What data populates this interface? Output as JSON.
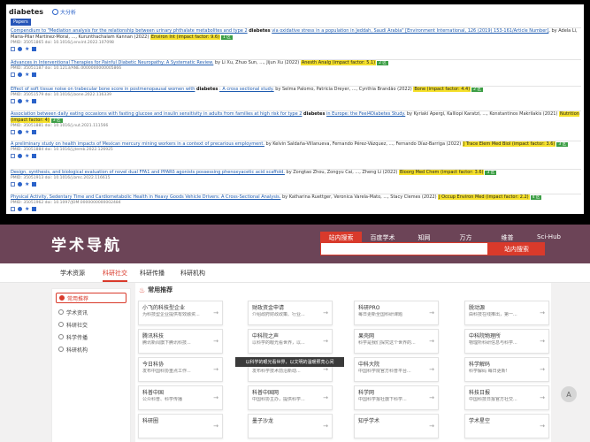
{
  "top": {
    "query": "diabetes",
    "lang_link": "大分析",
    "tab_label": "Papers",
    "results": [
      {
        "link": "Compendium to \"Mediation analysis for the relationship between urinary phthalate metabolites and type 2",
        "kw": "diabetes",
        "link2": "via oxidative stress in a population in Jeddah, Saudi Arabia\" [Environment International, 126 (2019) 153-161/Article Number]",
        "authors": ", by Adela Li, Maria-Pilar Martinez-Moral, ..., Kurunthachalam Kannan (2022)",
        "journal": "Environ Int (impact factor: 9.6)",
        "badge": "1 区",
        "meta": "PMID: 35051865 doi: 10.1016/j.envint.2022.107098"
      },
      {
        "link": "Advances in Interventional Therapies for Painful Diabetic Neuropathy: A Systematic Review.",
        "kw": "",
        "link2": "",
        "authors": " by Li Xu, Zhuo Sun, ..., Jijun Xu (2022)",
        "journal": "Anesth Analg (impact factor: 5.1)",
        "badge": "2 区",
        "meta": "PMID: 35051187 doi: 10.1213/ANE.0000000000005866"
      },
      {
        "link": "Effect of soft tissue noise on trabecular bone score in postmenopausal women with",
        "kw": "diabetes",
        "link2": ": A cross sectional study.",
        "authors": " by Selma Palomo, Patricia Dreyer, ..., Cynthia Brandão (2022)",
        "journal": "Bone (impact factor: 4.4)",
        "badge": "2 区",
        "meta": "PMID: 35051579 doi: 10.1016/j.bone.2022.116339"
      },
      {
        "link": "Association between daily eating occasions with fasting glucose and insulin sensitivity in adults from families at high risk for type 2",
        "kw": "diabetes",
        "link2": "in Europe: the Feel4Diabetes Study.",
        "authors": " by Kyriaki Apergi, Kalliopi Karatzi, ..., Konstantinos Makrilakis (2021)",
        "journal": "Nutrition (impact factor: 4)",
        "badge": "3 区",
        "meta": "PMID: 35051881 doi: 10.1016/j.nut.2021.111566"
      },
      {
        "link": "A preliminary study on health impacts of Mexican mercury mining workers in a context of precarious employment.",
        "kw": "",
        "link2": "",
        "authors": " by Kelvin Saldaña-Villanueva, Fernando Pérez-Vázquez, ..., Fernando Díaz-Barriga (2022)",
        "journal": "J Trace Elem Med Biol (impact factor: 3.6)",
        "badge": "3 区",
        "meta": "PMID: 35051884 doi: 10.1016/j.jtemb.2022.126925"
      },
      {
        "link": "Design, synthesis, and biological evaluation of novel dual FFA1 and PPARδ agonists possessing phenoxyacetic acid scaffold.",
        "kw": "",
        "link2": "",
        "authors": " by Zongtao Zhou, Zongyu Cai, ..., Zheng Li (2022)",
        "journal": "Bioorg Med Chem (impact factor: 3.6)",
        "badge": "3 区",
        "meta": "PMID: 35051913 doi: 10.1016/j.bmc.2022.116615"
      },
      {
        "link": "Physical Activity, Sedentary Time and Cardiometabolic Health in Heavy Goods Vehicle Drivers: A Cross-Sectional Analysis.",
        "kw": "",
        "link2": "",
        "authors": " by Katharina Ruettger, Veronica Varela-Mato, ..., Stacy Clemes (2022)",
        "journal": "J Occup Environ Med (impact factor: 2.2)",
        "badge": "4 区",
        "meta": "PMID: 35051962 doi: 10.1097/JOM.0000000000002484"
      }
    ]
  },
  "bottom": {
    "logo": "学术导航",
    "search_tabs": [
      "站内搜索",
      "百度学术",
      "知网",
      "万方",
      "维普",
      "Sci-Hub"
    ],
    "search_button": "站内搜索",
    "nav": [
      "学术资源",
      "科研社交",
      "科研传播",
      "科研机构"
    ],
    "sidebar": [
      "常用推荐",
      "学术资讯",
      "科研社交",
      "科学传播",
      "科研机构"
    ],
    "section_title": "常用推荐",
    "cards": [
      {
        "t": "小飞的科技型企业",
        "d": "为科技型企业提供有效融资..."
      },
      {
        "t": "财政资金申请",
        "d": "介绍政府财政政策、行业..."
      },
      {
        "t": "科研PRO",
        "d": "每日更新全国科研课题"
      },
      {
        "t": "脱动源",
        "d": "由科技在线推出，第一..."
      },
      {
        "t": "腾讯科技",
        "d": "腾讯新闻旗下腾讯科技..."
      },
      {
        "t": "中科院之声",
        "d": "以科学的眼光看世界，以..."
      },
      {
        "t": "果壳网",
        "d": "科学是我们探究这个世界的..."
      },
      {
        "t": "中科院物理所",
        "d": "物理所科研信息与科学..."
      },
      {
        "t": "今日科协",
        "d": "发布中国科协重点工作..."
      },
      {
        "t": "我科技",
        "d": "发布科学技术前沿新动..."
      },
      {
        "t": "中科大院",
        "d": "中国科学院官方科普平台..."
      },
      {
        "t": "科学解码",
        "d": "科学解码 每日更新!"
      },
      {
        "t": "科普中国",
        "d": "公众科普、科学传播"
      },
      {
        "t": "科普中国网",
        "d": "中国科协主办，提供科学..."
      },
      {
        "t": "科学网",
        "d": "中国科学报社旗下科学..."
      },
      {
        "t": "科技日报",
        "d": "中国科技日报官方社交..."
      },
      {
        "t": "科研圈",
        "d": ""
      },
      {
        "t": "墨子沙龙",
        "d": ""
      },
      {
        "t": "知乎学术",
        "d": ""
      },
      {
        "t": "学术星空",
        "d": ""
      }
    ],
    "tooltip": "以科学的眼光看世界，以文明的温暖照亮心间",
    "totop": "A"
  },
  "colors": {
    "accent": "#d93a2b",
    "banner": "#6c4457",
    "link": "#1e5bb0",
    "highlight": "#f5e02b",
    "badge": "#3c9e45"
  }
}
